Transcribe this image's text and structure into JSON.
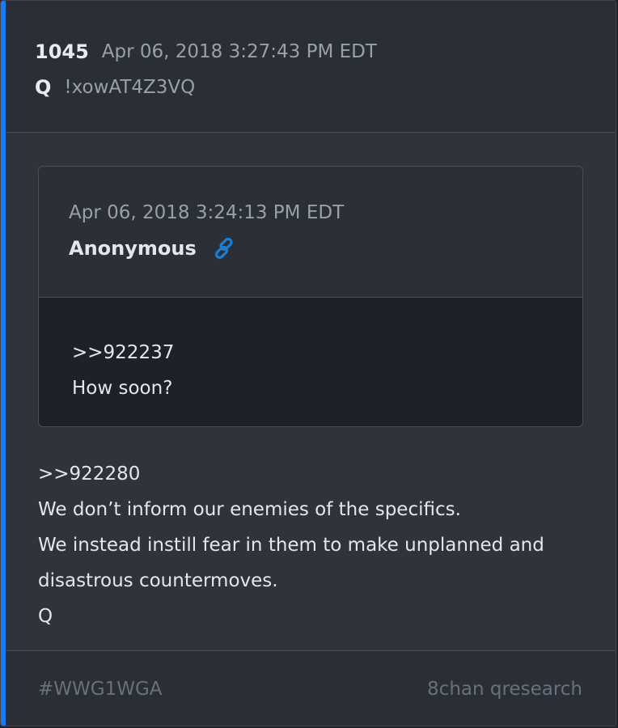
{
  "colors": {
    "accent_bar": "#1a7af5",
    "card_background": "#2f333c",
    "header_background": "#2a2e36",
    "quote_body_background": "#1f2128",
    "link_icon": "#1a7fd1",
    "primary_text": "#e4e6ea",
    "secondary_text": "#9aa0a9",
    "footer_text": "#6a707a"
  },
  "post": {
    "number": "1045",
    "date": "Apr 06, 2018 3:27:43 PM EDT",
    "author": "Q",
    "tripcode": "!xowAT4Z3VQ",
    "body_lines": [
      ">>922280",
      "We don’t inform our enemies of the specifics.",
      "We instead instill fear in them to make unplanned and",
      "disastrous countermoves.",
      "Q"
    ]
  },
  "quote": {
    "date": "Apr 06, 2018 3:24:13 PM EDT",
    "author": "Anonymous",
    "link_icon": "link-icon",
    "body_lines": [
      ">>922237",
      "How soon?"
    ]
  },
  "footer": {
    "hashtag": "#WWG1WGA",
    "source": "8chan qresearch"
  }
}
